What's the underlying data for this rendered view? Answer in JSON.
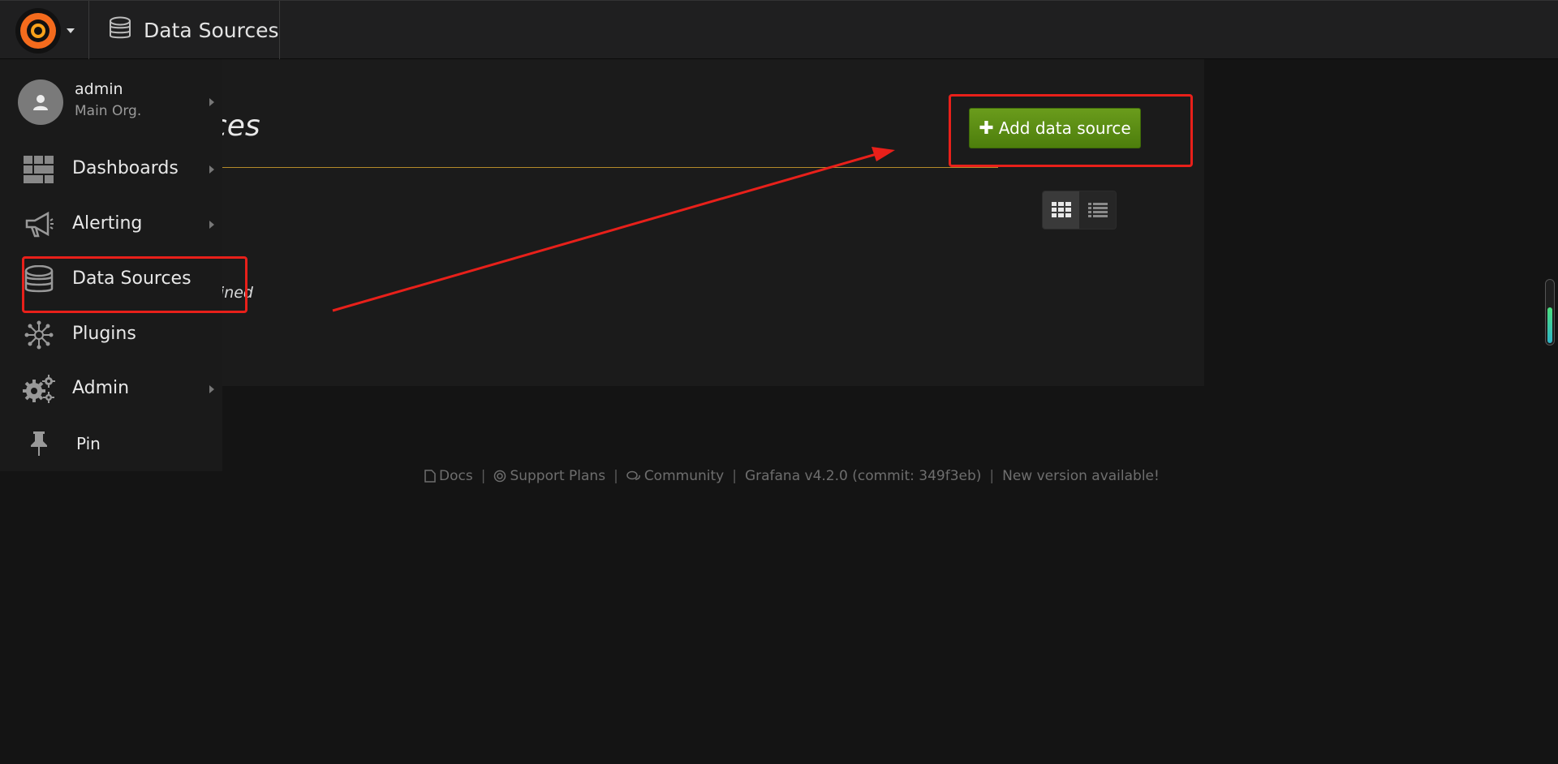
{
  "navbar": {
    "logo_name": "grafana-logo",
    "crumb_label": "Data Sources"
  },
  "page": {
    "title": "Data Sources",
    "add_button_label": "Add data source",
    "empty_message": "No data sources defined"
  },
  "sidemenu": {
    "user": {
      "name": "admin",
      "org": "Main Org."
    },
    "items": [
      {
        "label": "Dashboards",
        "icon": "dashboards-icon",
        "has_submenu": true
      },
      {
        "label": "Alerting",
        "icon": "megaphone-icon",
        "has_submenu": true
      },
      {
        "label": "Data Sources",
        "icon": "database-icon",
        "has_submenu": false
      },
      {
        "label": "Plugins",
        "icon": "plugins-icon",
        "has_submenu": false
      },
      {
        "label": "Admin",
        "icon": "gears-icon",
        "has_submenu": true
      },
      {
        "label": "Pin",
        "icon": "pin-icon",
        "has_submenu": false
      }
    ]
  },
  "footer": {
    "docs": "Docs",
    "support": "Support Plans",
    "community": "Community",
    "version": "Grafana v4.2.0 (commit: 349f3eb)",
    "update": "New version available!"
  },
  "colors": {
    "accent_green": "#5a8e14",
    "annotation_red": "#e8201a",
    "title_underline": "#b48a2a"
  }
}
